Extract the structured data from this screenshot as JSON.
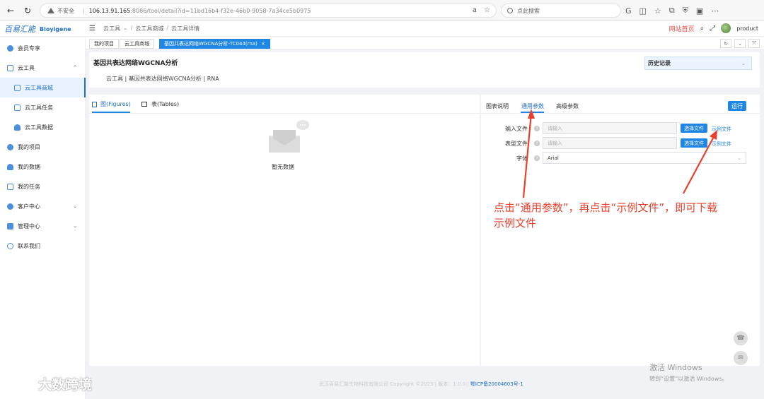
{
  "browser": {
    "security_label": "不安全",
    "url_host": "106.13.91.165",
    "url_path": ":8086/tool/detail?id=11bd16b4-f32e-46b0-9058-7a34ce5b0975",
    "search_placeholder": "点此搜索"
  },
  "header": {
    "logo_cn": "百易汇能",
    "logo_en": "Bioyigene",
    "breadcrumb": [
      "云工具",
      "云工具商城",
      "云工具详情"
    ],
    "site_home": "网站首页",
    "user": "product"
  },
  "sidebar": {
    "items": [
      {
        "label": "会员专享",
        "color": "#4a8fe0"
      },
      {
        "label": "云工具",
        "color": "#4a8fe0"
      },
      {
        "label": "云工具商城",
        "color": "#4a8fe0"
      },
      {
        "label": "云工具任务",
        "color": "#4a8fe0"
      },
      {
        "label": "云工具数据",
        "color": "#4a8fe0"
      },
      {
        "label": "我的项目",
        "color": "#4a8fe0"
      },
      {
        "label": "我的数据",
        "color": "#4a8fe0"
      },
      {
        "label": "我的任务",
        "color": "#4a8fe0"
      },
      {
        "label": "客户中心",
        "color": "#4a8fe0"
      },
      {
        "label": "管理中心",
        "color": "#4a8fe0"
      },
      {
        "label": "联系我们",
        "color": "#4a8fe0"
      }
    ]
  },
  "tabs": [
    "我的项目",
    "云工具商城",
    "基因共表达网络WGCNA分析-TC044(rna)"
  ],
  "page": {
    "title": "基因共表达网络WGCNA分析",
    "subline": "云工具 | 基因共表达网络WGCNA分析 | RNA",
    "history": "历史记录"
  },
  "left_panel": {
    "tab_figures": "图(Figures)",
    "tab_tables": "表(Tables)",
    "empty_text": "暂无数据"
  },
  "right_panel": {
    "tabs": [
      "图表说明",
      "通用参数",
      "高级参数"
    ],
    "run": "运行",
    "fields": [
      {
        "label": "输入文件",
        "placeholder": "请输入",
        "button": "选择文件",
        "link": "示例文件"
      },
      {
        "label": "表型文件",
        "placeholder": "请输入",
        "button": "选择文件",
        "link": "示例文件"
      },
      {
        "label": "字体",
        "value": "Arial"
      }
    ]
  },
  "annotation": "点击“通用参数”，再点击“示例文件”，即可下载示例文件",
  "footer": {
    "copyright": "武汉百易汇能生物科技有限公司 Copyright ©2023 | 版本：1.0.0 |",
    "icp": "鄂ICP备20004603号-1"
  },
  "watermarks": {
    "windows_line1": "激活 Windows",
    "windows_line2": "转到“设置”以激活 Windows。",
    "brand": "大数跨境"
  },
  "colors": {
    "accent": "#1f86e5",
    "annotation": "#e8402d"
  }
}
